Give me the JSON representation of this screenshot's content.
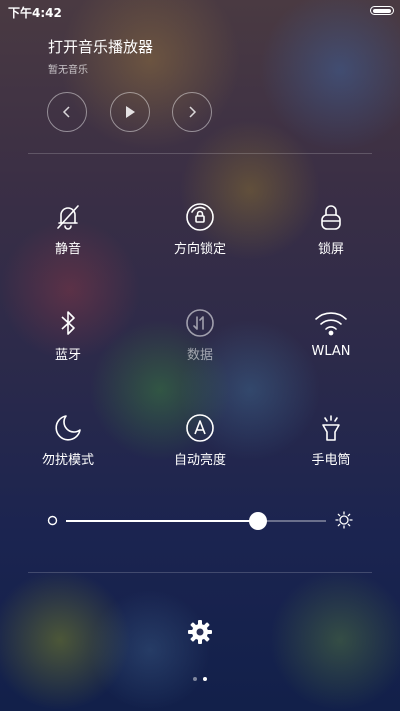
{
  "status_bar": {
    "time": "下午4:42"
  },
  "music": {
    "title": "打开音乐播放器",
    "subtitle": "暂无音乐"
  },
  "toggles": [
    {
      "label": "静音",
      "icon": "bell-off-icon",
      "active": true
    },
    {
      "label": "方向锁定",
      "icon": "rotation-lock-icon",
      "active": true
    },
    {
      "label": "锁屏",
      "icon": "lock-icon",
      "active": true
    },
    {
      "label": "蓝牙",
      "icon": "bluetooth-icon",
      "active": true
    },
    {
      "label": "数据",
      "icon": "mobile-data-icon",
      "active": false
    },
    {
      "label": "WLAN",
      "icon": "wifi-icon",
      "active": true
    },
    {
      "label": "勿扰模式",
      "icon": "moon-icon",
      "active": true
    },
    {
      "label": "自动亮度",
      "icon": "auto-brightness-icon",
      "active": true
    },
    {
      "label": "手电筒",
      "icon": "flashlight-icon",
      "active": true
    }
  ],
  "brightness": {
    "level": 0.74
  },
  "pager": {
    "count": 2,
    "current": 1
  }
}
